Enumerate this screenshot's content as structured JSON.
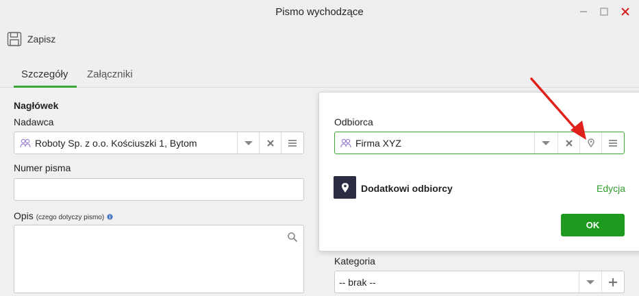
{
  "window": {
    "title": "Pismo wychodzące"
  },
  "toolbar": {
    "save_label": "Zapisz"
  },
  "tabs": [
    {
      "label": "Szczegóły",
      "active": true
    },
    {
      "label": "Załączniki",
      "active": false
    }
  ],
  "form": {
    "header_label": "Nagłówek",
    "sender_label": "Nadawca",
    "sender_value": "Roboty Sp. z o.o. Kościuszki 1, Bytom",
    "number_label": "Numer pisma",
    "number_value": "",
    "description_label": "Opis",
    "description_hint": "(czego dotyczy pismo)",
    "description_value": "",
    "category_label": "Kategoria",
    "category_value": "-- brak --"
  },
  "popup": {
    "recipient_label": "Odbiorca",
    "recipient_value": "Firma XYZ",
    "additional_label": "Dodatkowi odbiorcy",
    "edit_label": "Edycja",
    "ok_label": "OK"
  },
  "colors": {
    "accent_green": "#3aa635",
    "ok_button": "#1e9a1e",
    "close_red": "#d42020",
    "annotation_arrow": "#e0201a",
    "pin_badge": "#2b2d42"
  },
  "icons": [
    "save-icon",
    "people-icon",
    "dropdown-icon",
    "clear-icon",
    "menu-icon",
    "location-pin-icon",
    "search-icon",
    "info-icon",
    "plus-icon"
  ]
}
